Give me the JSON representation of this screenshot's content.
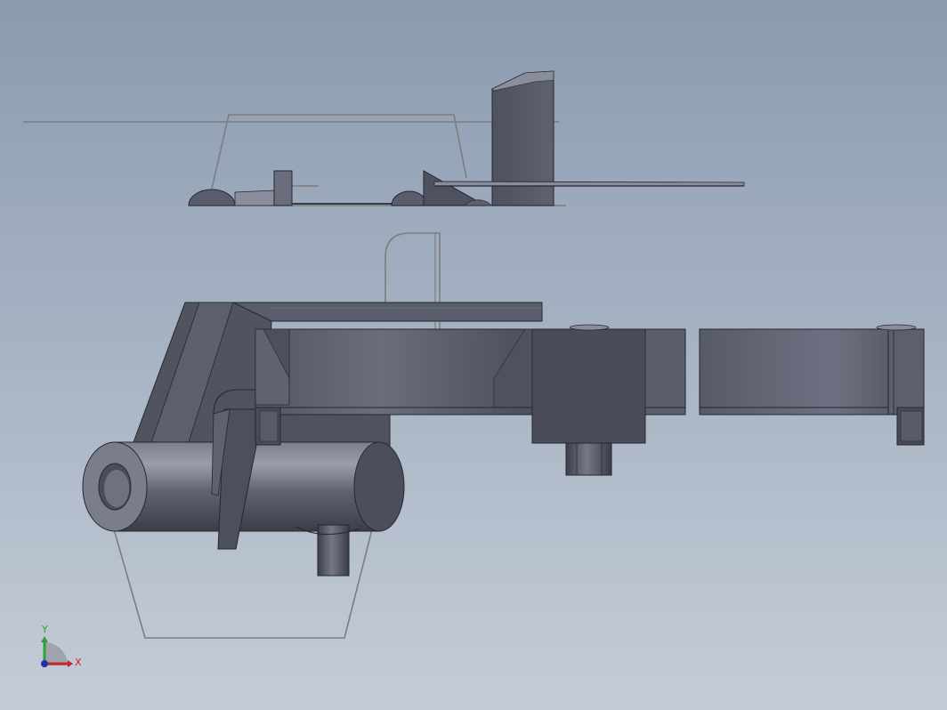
{
  "viewport": {
    "colors": {
      "background_top": "#8a9bb0",
      "background_bottom": "#c5ccd7",
      "body_dark": "#4a4e5c",
      "body_mid": "#5a5e6c",
      "body_light": "#8a8e9c",
      "sketch_line": "#7d7d7d",
      "edge": "#25272e"
    },
    "triad": {
      "x_label": "X",
      "y_label": "Y",
      "x_color": "#c0282c",
      "y_color": "#2aa43a",
      "z_color": "#2430b0"
    }
  }
}
